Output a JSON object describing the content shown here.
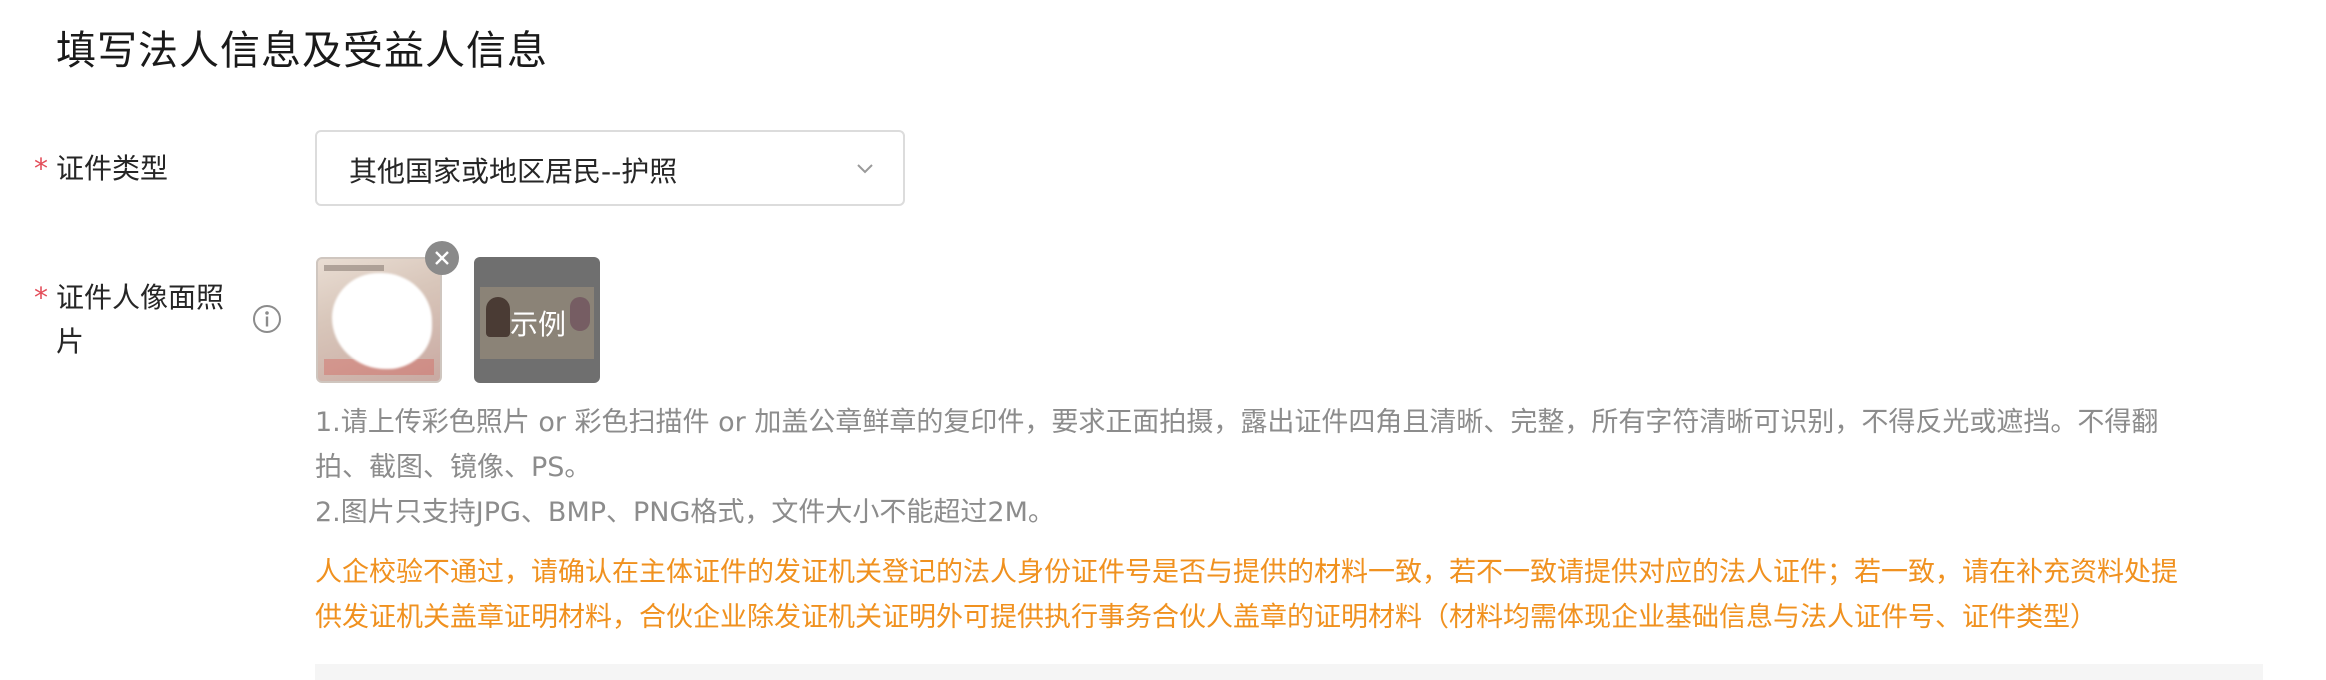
{
  "page": {
    "title": "填写法人信息及受益人信息"
  },
  "form": {
    "required_mark": "*",
    "id_type": {
      "label": "证件类型",
      "value": "其他国家或地区居民--护照"
    },
    "id_photo": {
      "label_line1": "证件人像面照",
      "label_line2": "片",
      "sample_label": "示例"
    },
    "hints": [
      "1.请上传彩色照片 or 彩色扫描件 or 加盖公章鲜章的复印件，要求正面拍摄，露出证件四角且清晰、完整，所有字符清晰可识别，不得反光或遮挡。不得翻",
      "拍、截图、镜像、PS。",
      "2.图片只支持JPG、BMP、PNG格式，文件大小不能超过2M。"
    ],
    "warning": [
      "人企校验不通过，请确认在主体证件的发证机关登记的法人身份证件号是否与提供的材料一致，若不一致请提供对应的法人证件；若一致，请在补充资料处提",
      "供发证机关盖章证明材料，合伙企业除发证机关证明外可提供执行事务合伙人盖章的证明材料（材料均需体现企业基础信息与法人证件号、证件类型）"
    ]
  },
  "colors": {
    "required": "#e34d59",
    "warning": "#f0911f",
    "hint": "#8c8c8c"
  },
  "icons": {
    "select": "chevron-down-icon",
    "info": "info-circle-icon",
    "remove": "close-icon"
  }
}
